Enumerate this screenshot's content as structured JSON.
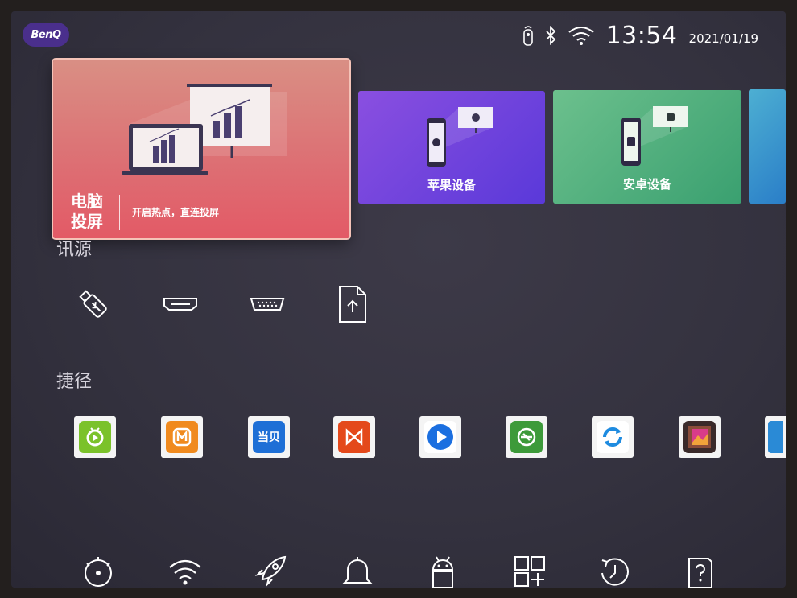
{
  "status_bar": {
    "logo": "BenQ",
    "time": "13:54",
    "date": "2021/01/19",
    "icons": [
      "remote-icon",
      "bluetooth-icon",
      "wifi-icon"
    ]
  },
  "tiles": {
    "pc_cast": {
      "title": "电脑\n投屏",
      "subtitle": "开启热点，直连投屏"
    },
    "apple": {
      "label": "苹果设备"
    },
    "android": {
      "label": "安卓设备"
    }
  },
  "sections": {
    "source": "讯源",
    "shortcuts": "捷径"
  },
  "sources": [
    "usb-icon",
    "hdmi-icon",
    "vga-icon",
    "file-upload-icon"
  ],
  "apps": [
    "app-green-tv",
    "app-mango",
    "app-dangbei",
    "app-red-player",
    "app-blue-player",
    "app-green-store",
    "app-sync",
    "app-gallery",
    "app-partial"
  ],
  "bottom_bar": [
    "settings-icon",
    "wifi-icon",
    "rocket-icon",
    "bell-icon",
    "android-icon",
    "add-app-icon",
    "history-icon",
    "help-icon"
  ],
  "colors": {
    "pc_tile": "#dd6e73",
    "apple_tile": "#6d44dd",
    "android_tile": "#55b37f",
    "logo": "#4a2f8c"
  }
}
